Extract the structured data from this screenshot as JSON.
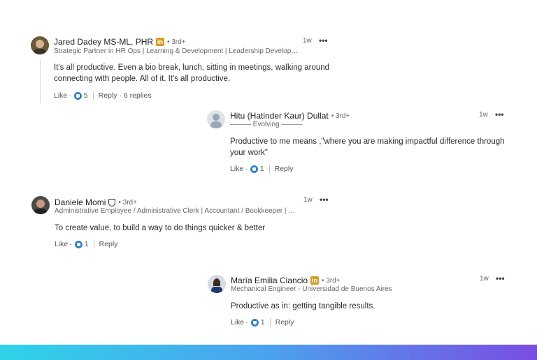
{
  "comments": [
    {
      "author": "Jared Dadey MS-ML, PHR",
      "degree": "• 3rd+",
      "headline": "Strategic Partner in HR Ops | Learning & Development | Leadership Develop…",
      "time": "1w",
      "text": "It's all productive. Even a bio break, lunch, sitting in meetings, walking around connecting with people. All of it. It's all productive.",
      "like_label": "Like",
      "reaction_count": "5",
      "reply_label": "Reply",
      "replies_label": "· 6 replies"
    },
    {
      "author": "Hitu (Hatinder Kaur) Dullat",
      "degree": "• 3rd+",
      "headline": "——— Evolving ———",
      "time": "1w",
      "text": "Productive to me means ,\"where you are making impactful difference through your work\"",
      "like_label": "Like",
      "reaction_count": "1",
      "reply_label": "Reply"
    },
    {
      "author": "Daniele Momi",
      "degree": "• 3rd+",
      "headline": "Administrative Employee / Administrative Clerk | Accountant / Bookkeeper | …",
      "time": "1w",
      "text": "To create value, to build a way to do things quicker & better",
      "like_label": "Like",
      "reaction_count": "1",
      "reply_label": "Reply"
    },
    {
      "author": "María Emilia Ciancio",
      "degree": "• 3rd+",
      "headline": "Mechanical Engineer - Universidad de Buenos Aires",
      "time": "1w",
      "text": "Productive as in: getting tangible results.",
      "like_label": "Like",
      "reaction_count": "1",
      "reply_label": "Reply"
    }
  ],
  "icons": {
    "linkedin_badge": "in",
    "more": "•••",
    "reaction": "like-reaction-icon",
    "verified": "shield-icon"
  },
  "colors": {
    "linkedin_gold": "#d89c1e",
    "reaction_blue": "#2f7fd6",
    "bar_gradient": [
      "#2fd3e8",
      "#4ba2ee",
      "#7a4de3"
    ]
  }
}
